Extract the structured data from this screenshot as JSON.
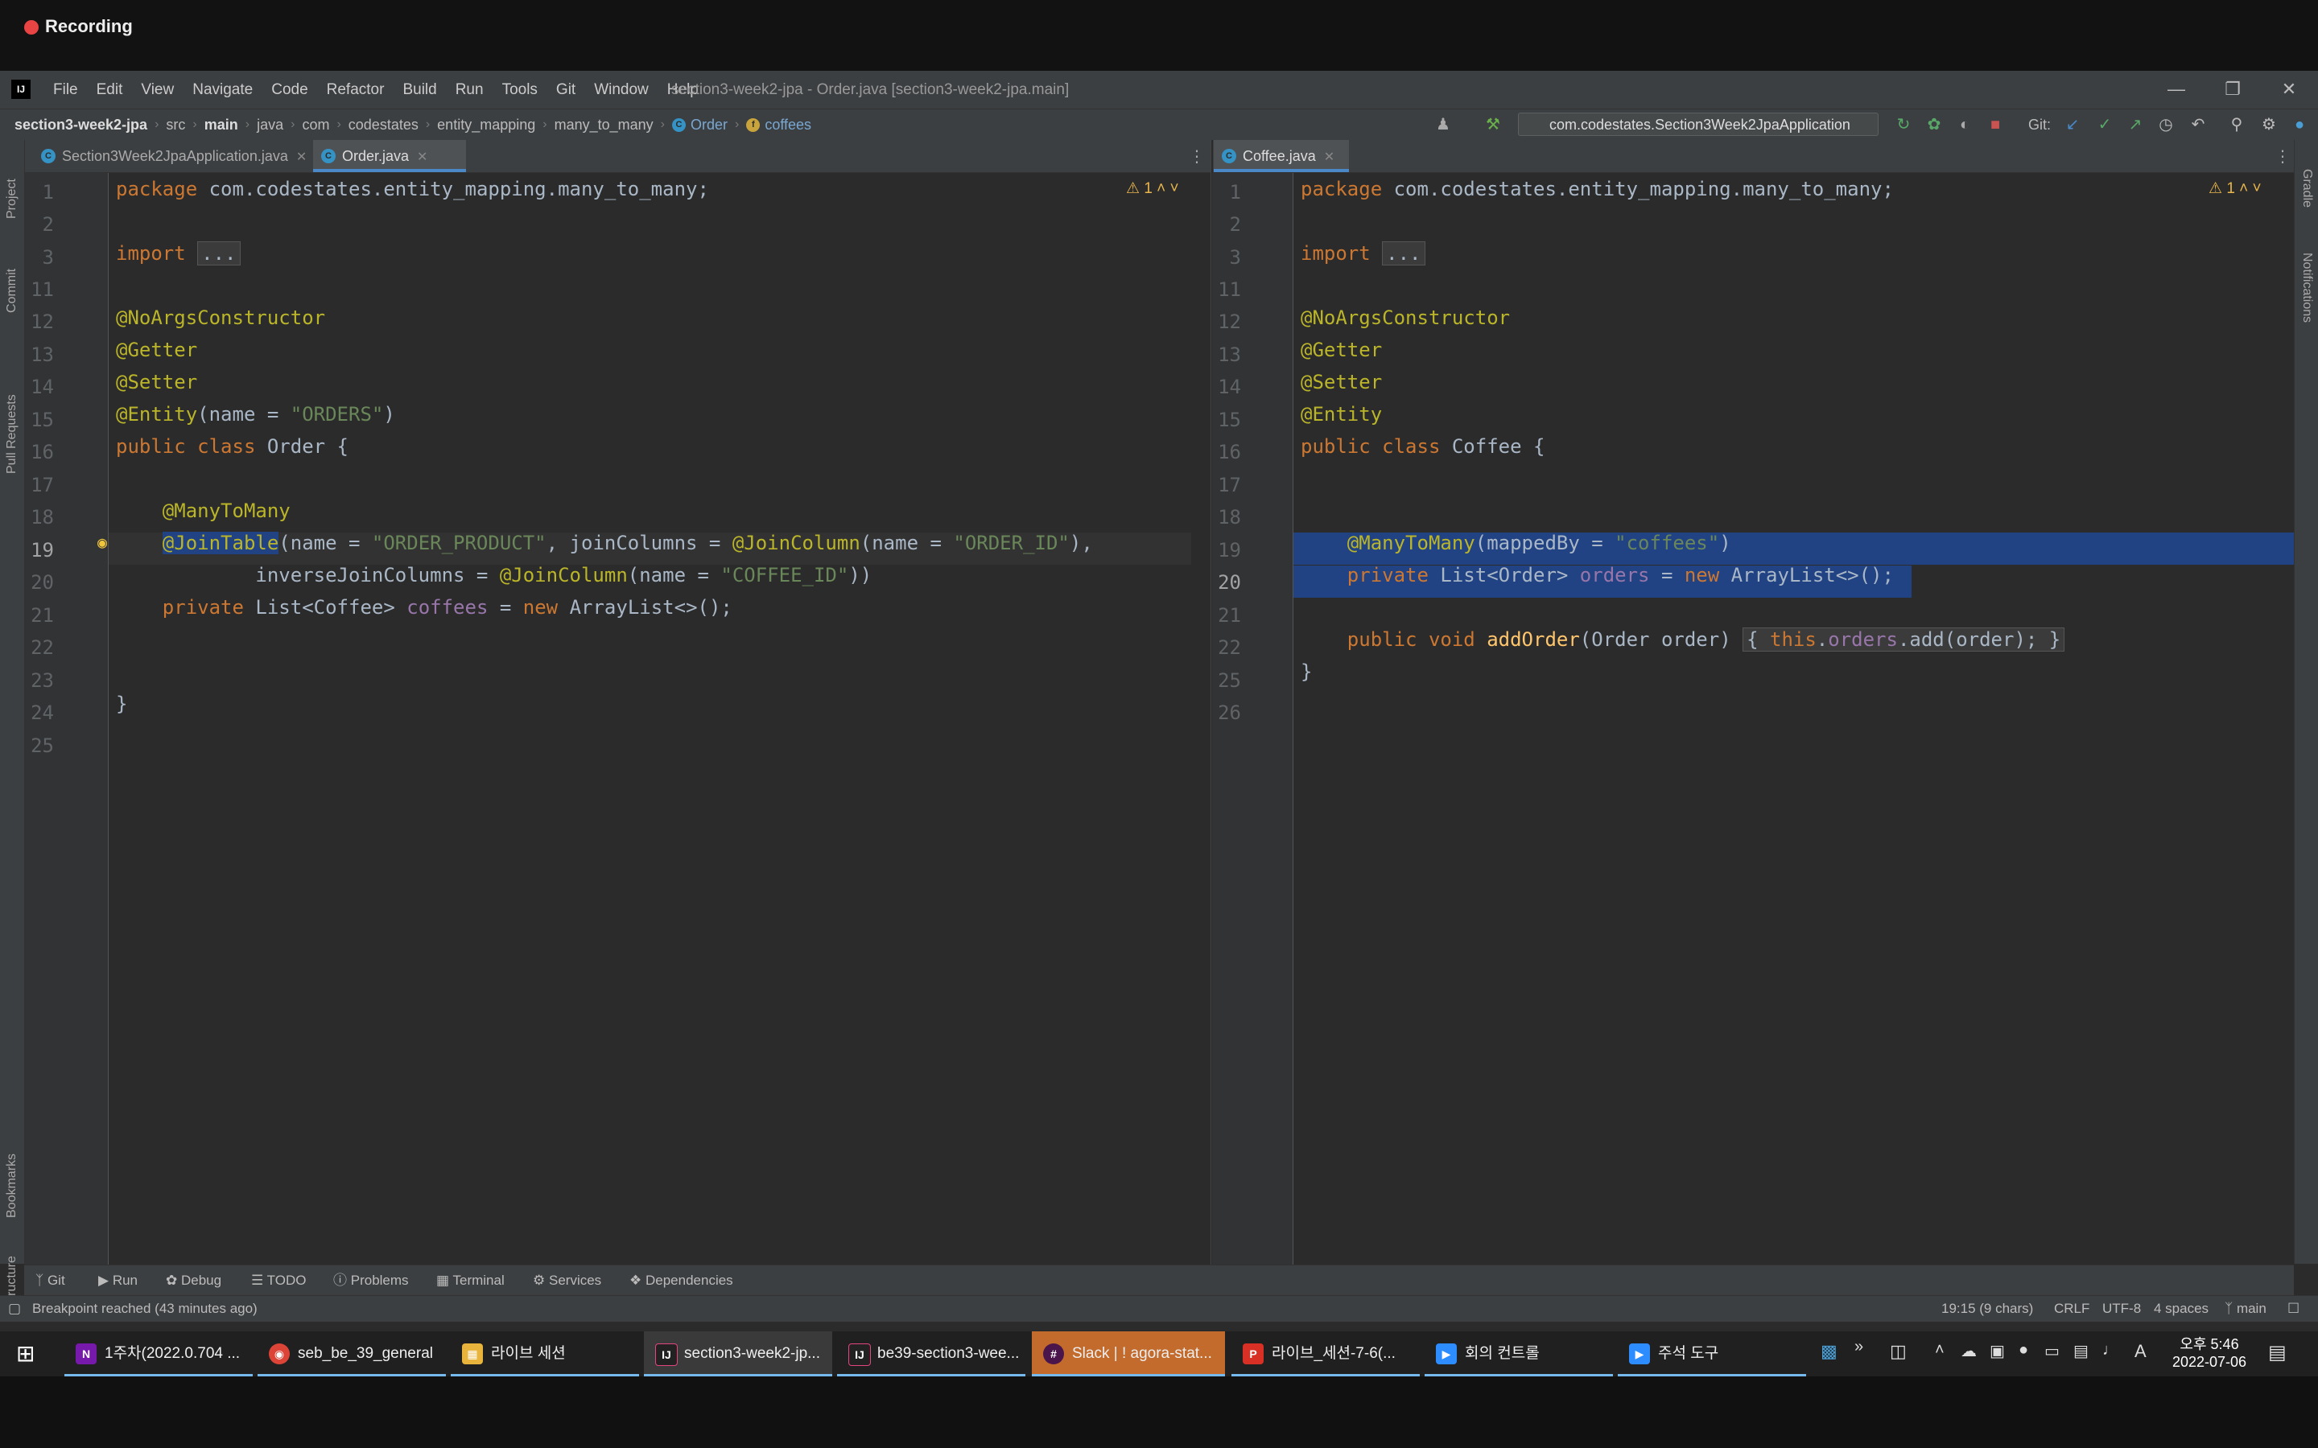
{
  "recording": {
    "label": "Recording",
    "color": "#e84444"
  },
  "ide": {
    "menu": [
      "File",
      "Edit",
      "View",
      "Navigate",
      "Code",
      "Refactor",
      "Build",
      "Run",
      "Tools",
      "Git",
      "Window",
      "Help"
    ],
    "window_title": "section3-week2-jpa - Order.java [section3-week2-jpa.main]",
    "breadcrumb": [
      "section3-week2-jpa",
      "src",
      "main",
      "java",
      "com",
      "codestates",
      "entity_mapping",
      "many_to_many",
      "Order",
      "coffees"
    ],
    "run_config": "com.codestates.Section3Week2JpaApplication",
    "git_label": "Git:",
    "left_tools": [
      "Project",
      "Commit",
      "Pull Requests",
      "Bookmarks",
      "Structure"
    ],
    "right_tools": [
      "Gradle",
      "Notifications"
    ],
    "left_tabs": [
      "Section3Week2JpaApplication.java",
      "Order.java"
    ],
    "right_tabs": [
      "Coffee.java"
    ],
    "left_warning": "1",
    "right_warning": "1",
    "left_line_numbers": [
      "1",
      "2",
      "3",
      "11",
      "12",
      "13",
      "14",
      "15",
      "16",
      "17",
      "18",
      "19",
      "20",
      "21",
      "22",
      "23",
      "24",
      "25"
    ],
    "right_line_numbers": [
      "1",
      "2",
      "3",
      "11",
      "12",
      "13",
      "14",
      "15",
      "16",
      "17",
      "18",
      "19",
      "20",
      "21",
      "22",
      "25",
      "26"
    ],
    "tool_windows": [
      "Git",
      "Run",
      "Debug",
      "TODO",
      "Problems",
      "Terminal",
      "Services",
      "Dependencies"
    ],
    "status_message": "Breakpoint reached (43 minutes ago)",
    "status_right": [
      "19:15 (9 chars)",
      "CRLF",
      "UTF-8",
      "4 spaces",
      "main"
    ]
  },
  "taskbar": {
    "items": [
      "1주차(2022.0.704 ...",
      "seb_be_39_general ...",
      "라이브 세션",
      "section3-week2-jp...",
      "be39-section3-wee...",
      "Slack | ! agora-stat...",
      "라이브_세션-7-6(...",
      "회의 컨트롤",
      "주석 도구"
    ],
    "time": "오후 5:46",
    "date": "2022-07-06",
    "ime": "A"
  },
  "colors": {
    "accent": "#4a88c7",
    "selection": "#214283",
    "keyword": "#cc7832",
    "annotation": "#bbb529",
    "string": "#6a8759",
    "field": "#9876aa"
  }
}
